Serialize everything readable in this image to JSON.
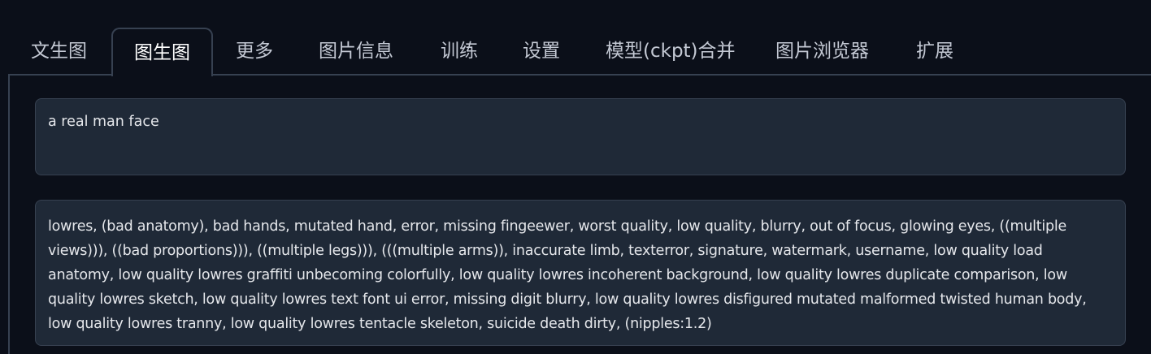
{
  "tabs": [
    {
      "label": "文生图",
      "active": false
    },
    {
      "label": "图生图",
      "active": true
    },
    {
      "label": "更多",
      "active": false
    },
    {
      "label": "图片信息",
      "active": false
    },
    {
      "label": "训练",
      "active": false
    },
    {
      "label": "设置",
      "active": false
    },
    {
      "label": "模型(ckpt)合并",
      "active": false
    },
    {
      "label": "图片浏览器",
      "active": false
    },
    {
      "label": "扩展",
      "active": false
    }
  ],
  "prompt": {
    "positive": "a real man face",
    "negative": "lowres, (bad anatomy), bad hands, mutated hand, error, missing fingeewer, worst quality, low quality, blurry, out of focus, glowing eyes, ((multiple views))), ((bad proportions))), ((multiple legs))), (((multiple arms)), inaccurate limb, texterror, signature, watermark, username, low quality load anatomy, low quality lowres graffiti unbecoming colorfully, low quality lowres incoherent background, low quality lowres duplicate comparison, low quality lowres sketch, low quality lowres text font ui error, missing digit blurry, low quality lowres disfigured mutated malformed twisted human body, low quality lowres tranny, low quality lowres tentacle skeleton, suicide death dirty, (nipples:1.2)"
  },
  "colors": {
    "background": "#0b0f19",
    "panel_border": "#374151",
    "textbox_background": "#1f2937",
    "text": "#e5e7eb",
    "tab_text": "#c4c9d4",
    "tab_active_text": "#ffffff"
  }
}
